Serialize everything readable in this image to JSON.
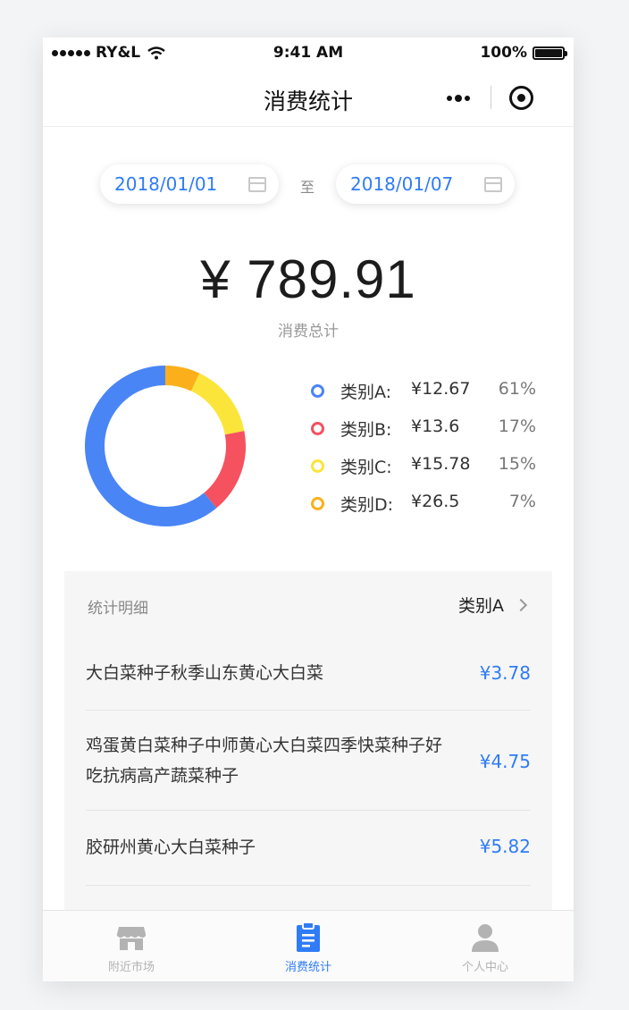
{
  "status_bar": {
    "carrier": "RY&L",
    "time": "9:41 AM",
    "battery": "100%",
    "battery_level": 1.0
  },
  "nav": {
    "title": "消费统计",
    "more_icon": "more-dots-icon",
    "target_icon": "target-icon"
  },
  "date_range": {
    "start": "2018/01/01",
    "separator": "至",
    "end": "2018/01/07",
    "icon": "calendar-icon"
  },
  "summary": {
    "total": "¥ 789.91",
    "label": "消费总计"
  },
  "chart_data": {
    "type": "pie",
    "categories": [
      "类别A",
      "类别B",
      "类别C",
      "类别D"
    ],
    "values": [
      12.67,
      13.6,
      15.78,
      26.5
    ],
    "value_labels": [
      "¥12.67",
      "¥13.6",
      "¥15.78",
      "¥26.5"
    ],
    "percent_labels": [
      "61%",
      "17%",
      "15%",
      "7%"
    ],
    "percents": [
      61,
      17,
      15,
      7
    ],
    "colors": [
      "#4a85f6",
      "#f5515f",
      "#fbe53b",
      "#fbb01b"
    ],
    "donut": true,
    "legend_position": "right"
  },
  "detail": {
    "title": "统计明细",
    "filter": "类别A",
    "items": [
      {
        "name": "大白菜种子秋季山东黄心大白菜",
        "price": "¥3.78"
      },
      {
        "name": "鸡蛋黄白菜种子中师黄心大白菜四季快菜种子好吃抗病高产蔬菜种子",
        "price": "¥4.75"
      },
      {
        "name": "胶研州黄心大白菜种子",
        "price": "¥5.82"
      }
    ]
  },
  "tabbar": {
    "tabs": [
      {
        "label": "附近市场",
        "icon": "store-icon",
        "active": false
      },
      {
        "label": "消费统计",
        "icon": "clipboard-icon",
        "active": true
      },
      {
        "label": "个人中心",
        "icon": "user-icon",
        "active": false
      }
    ],
    "active_color": "#2f7cf6",
    "inactive_color": "#b3b3b3"
  }
}
